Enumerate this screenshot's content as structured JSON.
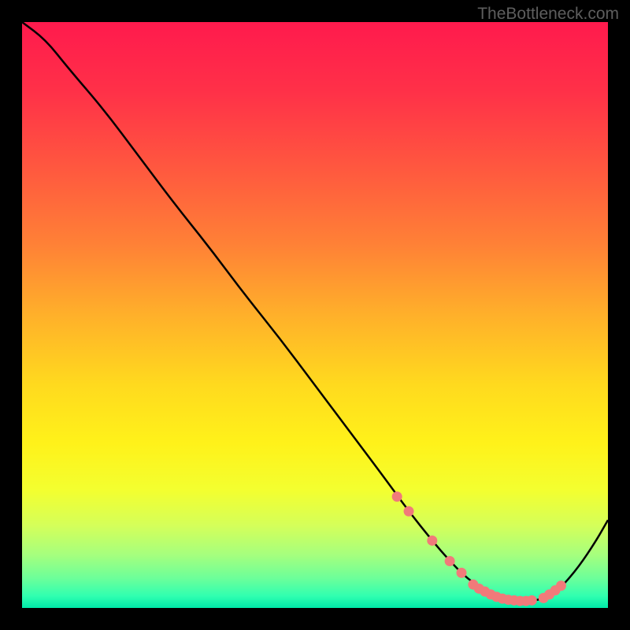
{
  "watermark": "TheBottleneck.com",
  "chart_data": {
    "type": "line",
    "title": "",
    "xlabel": "",
    "ylabel": "",
    "xlim": [
      0,
      100
    ],
    "ylim": [
      0,
      100
    ],
    "curve": {
      "x": [
        0,
        4,
        8,
        14,
        20,
        26,
        32,
        38,
        44,
        50,
        56,
        62,
        66,
        70,
        73,
        76,
        79,
        82,
        85,
        88,
        90,
        92,
        95,
        98,
        100
      ],
      "y": [
        100,
        97,
        92,
        85,
        77,
        69,
        61.5,
        53.5,
        46,
        38,
        30,
        22,
        16.5,
        11.5,
        8,
        5,
        3,
        1.8,
        1.2,
        1.3,
        2,
        3.5,
        7,
        11.5,
        15
      ]
    },
    "markers": {
      "x": [
        64,
        66,
        70,
        73,
        75,
        77,
        78,
        79,
        80,
        81,
        82,
        83,
        84,
        85,
        86,
        87,
        89,
        90,
        91,
        92
      ],
      "y": [
        19,
        16.5,
        11.5,
        8,
        6,
        4,
        3.3,
        2.8,
        2.3,
        1.9,
        1.6,
        1.4,
        1.3,
        1.2,
        1.2,
        1.3,
        1.7,
        2.3,
        3,
        3.8
      ],
      "color": "#f17a7a"
    },
    "background_gradient": {
      "stops": [
        {
          "offset": 0.0,
          "color": "#ff1a4d"
        },
        {
          "offset": 0.12,
          "color": "#ff3148"
        },
        {
          "offset": 0.25,
          "color": "#ff583f"
        },
        {
          "offset": 0.38,
          "color": "#ff8136"
        },
        {
          "offset": 0.5,
          "color": "#ffb02a"
        },
        {
          "offset": 0.62,
          "color": "#ffda1e"
        },
        {
          "offset": 0.72,
          "color": "#fff21a"
        },
        {
          "offset": 0.8,
          "color": "#f3ff30"
        },
        {
          "offset": 0.86,
          "color": "#d4ff5a"
        },
        {
          "offset": 0.91,
          "color": "#a5ff7e"
        },
        {
          "offset": 0.95,
          "color": "#6bff9a"
        },
        {
          "offset": 0.98,
          "color": "#2fffb0"
        },
        {
          "offset": 1.0,
          "color": "#00e8a8"
        }
      ]
    }
  }
}
